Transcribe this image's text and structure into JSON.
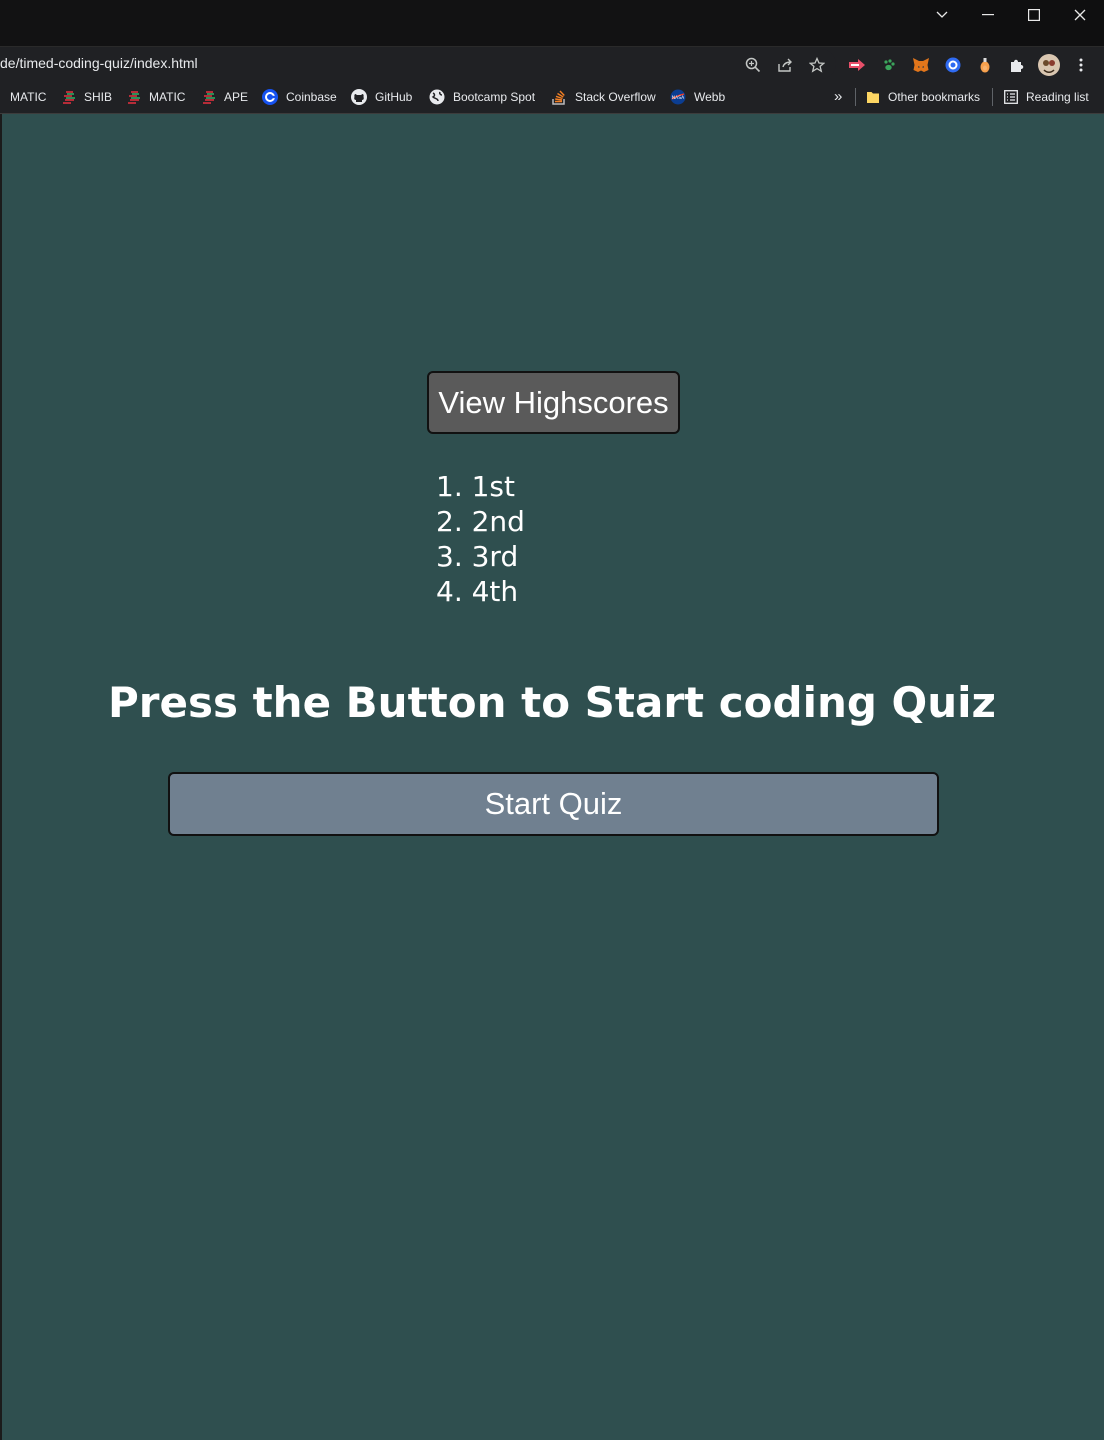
{
  "browser": {
    "url": "de/timed-coding-quiz/index.html",
    "window_controls": [
      "tab-search-icon",
      "minimize-icon",
      "maximize-icon",
      "close-icon"
    ],
    "toolbar_icons": [
      "zoom-icon",
      "share-icon",
      "bookmark-star-icon",
      "extension-arrow-icon",
      "extension-paw-icon",
      "metamask-fox-icon",
      "extension-circle-icon",
      "extension-dropper-icon",
      "extensions-puzzle-icon",
      "profile-avatar-icon",
      "menu-kebab-icon"
    ],
    "bookmarks": [
      {
        "label": "MATIC",
        "icon": "chart-ticker-icon"
      },
      {
        "label": "SHIB",
        "icon": "chart-ticker-icon"
      },
      {
        "label": "MATIC",
        "icon": "chart-ticker-icon"
      },
      {
        "label": "APE",
        "icon": "chart-ticker-icon"
      },
      {
        "label": "Coinbase",
        "icon": "coinbase-icon"
      },
      {
        "label": "GitHub",
        "icon": "github-icon"
      },
      {
        "label": "Bootcamp Spot",
        "icon": "globe-icon"
      },
      {
        "label": "Stack Overflow",
        "icon": "stackoverflow-icon"
      },
      {
        "label": "Webb",
        "icon": "nasa-icon"
      }
    ],
    "more_bookmarks": "»",
    "other_bookmarks": "Other bookmarks",
    "reading_list": "Reading list"
  },
  "quiz": {
    "highscores_button": "View Highscores",
    "highscores": [
      "1. 1st",
      "2. 2nd",
      "3. 3rd",
      "4. 4th"
    ],
    "prompt": "Press the Button to Start coding Quiz",
    "start_button": "Start Quiz"
  },
  "colors": {
    "page_background": "#2f4f4f",
    "highscores_button": "#5a5a5a",
    "start_button": "#708090"
  }
}
